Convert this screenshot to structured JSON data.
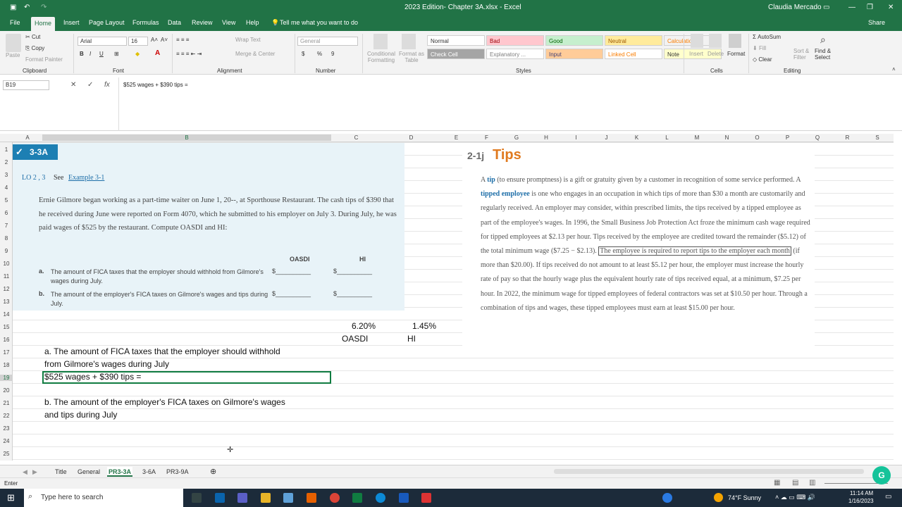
{
  "window": {
    "title": "2023 Edition- Chapter 3A.xlsx - Excel",
    "user": "Claudia Mercado",
    "share": "Share"
  },
  "tabs": [
    "File",
    "Home",
    "Insert",
    "Page Layout",
    "Formulas",
    "Data",
    "Review",
    "View",
    "Help"
  ],
  "tell_me": "Tell me what you want to do",
  "ribbon": {
    "clipboard": {
      "paste": "Paste",
      "cut": "Cut",
      "copy": "Copy",
      "format_painter": "Format Painter",
      "label": "Clipboard"
    },
    "font": {
      "name": "Arial",
      "size": "16",
      "label": "Font",
      "bold": "B",
      "italic": "I",
      "underline": "U"
    },
    "alignment": {
      "wrap": "Wrap Text",
      "merge": "Merge & Center",
      "label": "Alignment"
    },
    "number": {
      "format": "General",
      "label": "Number",
      "currency": "$",
      "percent": "%",
      "comma": "9"
    },
    "styles": {
      "cond": "Conditional Formatting",
      "table": "Format as Table",
      "items": [
        {
          "label": "Normal",
          "bg": "#ffffff",
          "fg": "#333333"
        },
        {
          "label": "Bad",
          "bg": "#ffc7ce",
          "fg": "#9c0006"
        },
        {
          "label": "Good",
          "bg": "#c6efce",
          "fg": "#006100"
        },
        {
          "label": "Neutral",
          "bg": "#ffeb9c",
          "fg": "#9c5700"
        },
        {
          "label": "Calculation",
          "bg": "#f2f2f2",
          "fg": "#fa7d00"
        },
        {
          "label": "Check Cell",
          "bg": "#a5a5a5",
          "fg": "#ffffff"
        },
        {
          "label": "Explanatory ...",
          "bg": "#ffffff",
          "fg": "#7f7f7f"
        },
        {
          "label": "Input",
          "bg": "#ffcc99",
          "fg": "#3f3f76"
        },
        {
          "label": "Linked Cell",
          "bg": "#ffffff",
          "fg": "#fa7d00"
        },
        {
          "label": "Note",
          "bg": "#ffffcc",
          "fg": "#333333"
        }
      ],
      "label": "Styles"
    },
    "cells": {
      "insert": "Insert",
      "delete": "Delete",
      "format": "Format",
      "label": "Cells"
    },
    "editing": {
      "autosum": "AutoSum",
      "fill": "Fill",
      "clear": "Clear",
      "sort": "Sort & Filter",
      "find": "Find & Select",
      "label": "Editing"
    }
  },
  "namebox": "B19",
  "formula": "$525 wages + $390 tips =",
  "columns": [
    "A",
    "B",
    "C",
    "D",
    "E",
    "F",
    "G",
    "H",
    "I",
    "J",
    "K",
    "L",
    "M",
    "N",
    "O",
    "P",
    "Q",
    "R",
    "S"
  ],
  "rows": [
    "1",
    "2",
    "3",
    "4",
    "5",
    "6",
    "7",
    "8",
    "9",
    "10",
    "11",
    "12",
    "13",
    "14",
    "15",
    "16",
    "17",
    "18",
    "19",
    "20",
    "21",
    "22",
    "23",
    "24",
    "25"
  ],
  "problem": {
    "badge": "3-3A",
    "lo": "LO 2 , 3",
    "see": "See",
    "example": "Example 3-1",
    "text": "Ernie Gilmore began working as a part-time waiter on June 1, 20--, at Sporthouse Restaurant. The cash tips of $390 that he received during June were reported on Form 4070, which he submitted to his employer on July 3. During July, he was paid wages of $525 by the restaurant. Compute OASDI and HI:",
    "col_oasdi": "OASDI",
    "col_hi": "HI",
    "a_letter": "a.",
    "a_text": "The amount of FICA taxes that the employer should withhold from Gilmore's wages during July.",
    "b_letter": "b.",
    "b_text": "The amount of the employer's FICA taxes on Gilmore's wages and tips during July.",
    "blank": "$__________"
  },
  "cells": {
    "c15": "6.20%",
    "d15": "1.45%",
    "c16": "OASDI",
    "d16": "HI",
    "b17": "a. The amount of FICA taxes that the employer should withhold",
    "b18": "from Gilmore's wages during July",
    "b19": "$525 wages + $390 tips =",
    "b21": "b. The amount of the employer's FICA taxes on Gilmore's wages",
    "b22": "and tips during July"
  },
  "tips": {
    "num": "2-1j",
    "title": "Tips",
    "p1a": "A ",
    "tip": "tip",
    "p1b": " (to ensure promptness) is a gift or gratuity given by a customer in recognition of some service performed. A ",
    "tipped": "tipped employee",
    "p1c": " is one who engages in an occupation in which tips of more than $30 a month are customarily and regularly received. An employer may consider, within prescribed limits, the tips received by a tipped employee as part of the employee's wages. In 1996, the Small Business Job Protection Act froze the minimum cash wage required for tipped employees at $2.13 per hour. Tips received by the employee are credited toward the remainder ($5.12) of the total minimum wage ($7.25 − $2.13).",
    "highlight": "The employee is required to report tips to the employer each month",
    "p1d": "if more than $20.00). If tips received do not amount to at least $5.12 per hour, the employer must increase the hourly rate of pay so that the hourly wage plus the equivalent hourly rate of tips received equal, at a minimum, $7.25 per hour. In 2022, the minimum wage for tipped employees of federal contractors was set at $10.50 per hour. Through a combination of tips and wages, these tipped employees must earn at least $15.00 per hour."
  },
  "sheets": [
    "Title",
    "General",
    "PR3-3A",
    "3-6A",
    "PR3-9A"
  ],
  "active_sheet": "PR3-3A",
  "status": "Enter",
  "taskbar": {
    "search": "Type here to search",
    "weather": "74°F  Sunny",
    "time": "11:14 AM",
    "date": "1/16/2023"
  },
  "colors": {
    "excel_green": "#217346",
    "selected_tab": "#217346"
  }
}
